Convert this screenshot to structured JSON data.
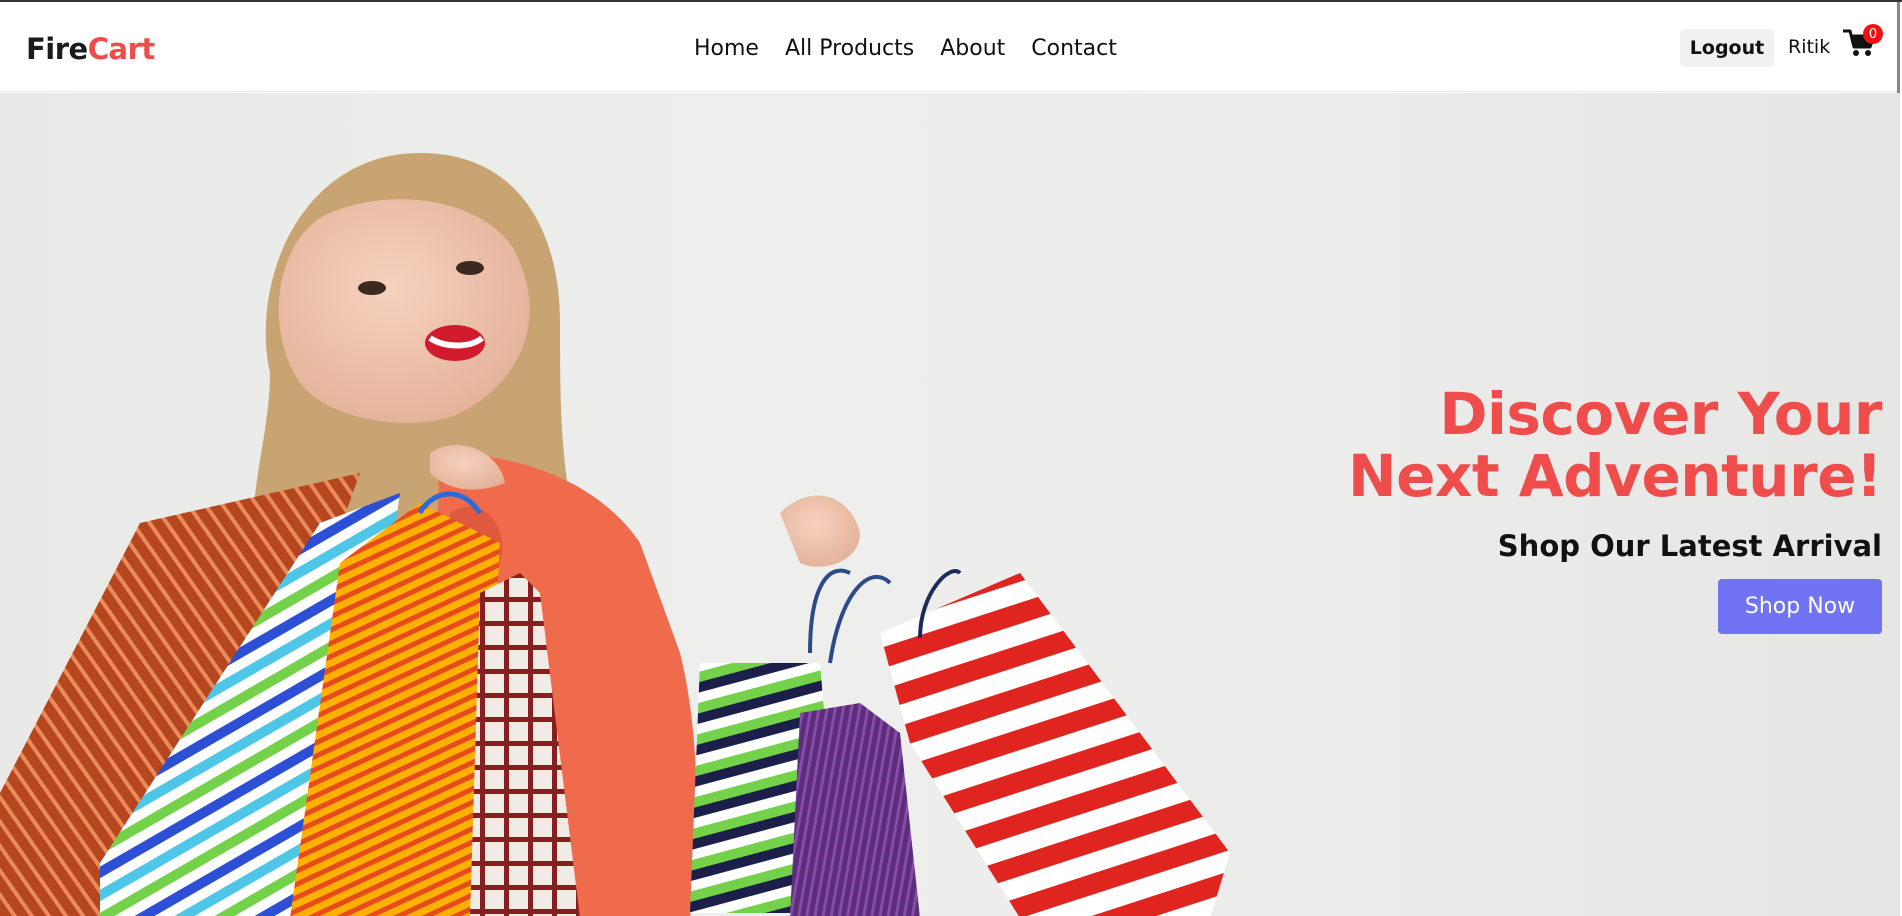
{
  "brand": {
    "part1": "Fire",
    "part2": "Cart",
    "accent": "#ef4c4c"
  },
  "nav": {
    "items": [
      "Home",
      "All Products",
      "About",
      "Contact"
    ]
  },
  "user": {
    "logout_label": "Logout",
    "name": "Ritik"
  },
  "cart": {
    "count": "0",
    "icon": "cart-icon"
  },
  "hero": {
    "title_line1": "Discover Your",
    "title_line2": "Next Adventure!",
    "subtitle": "Shop Our Latest Arrival",
    "cta_label": "Shop Now",
    "cta_color": "#6f73f4",
    "image": "woman-with-shopping-bags"
  }
}
